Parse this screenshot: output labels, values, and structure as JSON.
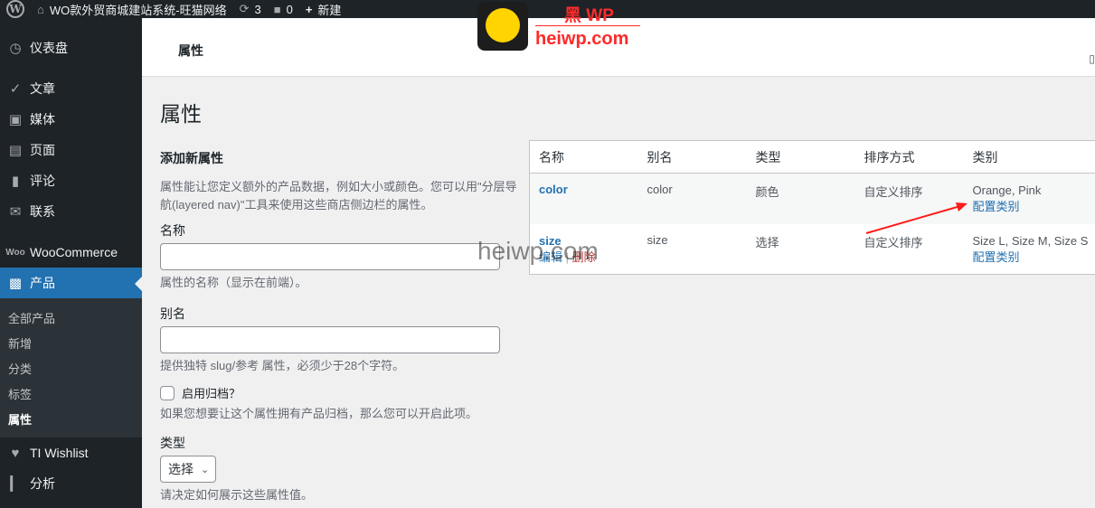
{
  "adminbar": {
    "site_name": "WO款外贸商城建站系统-旺猫网络",
    "updates_count": "3",
    "comments_count": "0",
    "new_label": "新建"
  },
  "sidebar": {
    "items": [
      {
        "label": "仪表盘",
        "icon": "dashboard-icon"
      },
      {
        "label": "文章",
        "icon": "pin-icon"
      },
      {
        "label": "媒体",
        "icon": "media-icon"
      },
      {
        "label": "页面",
        "icon": "page-icon"
      },
      {
        "label": "评论",
        "icon": "comment-icon"
      },
      {
        "label": "联系",
        "icon": "mail-icon"
      },
      {
        "label": "WooCommerce",
        "icon": "woo-icon"
      },
      {
        "label": "产品",
        "icon": "archive-icon"
      }
    ],
    "submenu": [
      "全部产品",
      "新增",
      "分类",
      "标签",
      "属性"
    ],
    "after": [
      {
        "label": "TI Wishlist",
        "icon": "heart-icon"
      },
      {
        "label": "分析",
        "icon": "chart-icon"
      }
    ]
  },
  "header": {
    "breadcrumb": "属性"
  },
  "page": {
    "title": "属性"
  },
  "form": {
    "heading": "添加新属性",
    "intro": "属性能让您定义额外的产品数据，例如大小或颜色。您可以用\"分层导航(layered nav)\"工具来使用这些商店侧边栏的属性。",
    "name_label": "名称",
    "name_desc": "属性的名称（显示在前端）。",
    "slug_label": "别名",
    "slug_desc": "提供独特 slug/参考 属性，必须少于28个字符。",
    "archive_label": "启用归档？",
    "archive_desc": "如果您想要让这个属性拥有产品归档，那么您可以开启此项。",
    "type_label": "类型",
    "type_value": "选择",
    "type_desc": "请决定如何展示这些属性值。"
  },
  "table": {
    "headers": [
      "名称",
      "别名",
      "类型",
      "排序方式",
      "类别"
    ],
    "rows": [
      {
        "name": "color",
        "slug": "color",
        "type": "颜色",
        "order": "自定义排序",
        "terms": "Orange, Pink",
        "configure": "配置类别"
      },
      {
        "name": "size",
        "slug": "size",
        "type": "选择",
        "order": "自定义排序",
        "terms": "Size L, Size M, Size S",
        "configure": "配置类别",
        "edit": "编辑",
        "delete": "删除"
      }
    ]
  },
  "watermark": {
    "brand_cn": "黑 WP",
    "brand_url": "heiwp.com",
    "overlay": "heiwp.com"
  },
  "colors": {
    "admin_dark": "#1d2327",
    "accent": "#2271b1",
    "link": "#2271b1",
    "delete": "#b32d2e",
    "brand_red": "#ff2a2a"
  }
}
